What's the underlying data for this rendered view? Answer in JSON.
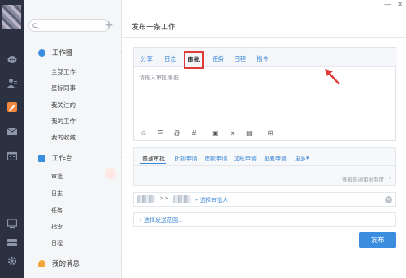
{
  "app": {
    "title": "发布一条工作"
  },
  "window": {
    "minimize": "—",
    "close": "✕"
  },
  "rail": {
    "icons": [
      "chat-icon",
      "contacts-icon",
      "work-icon",
      "mail-icon",
      "calendar-icon",
      "monitor-icon",
      "storage-icon",
      "settings-icon"
    ]
  },
  "sidebar": {
    "search_placeholder": "",
    "plus": "+",
    "groups": [
      {
        "label": "工作圈",
        "items": [
          "全部工作",
          "星标同事",
          "我关注的",
          "我的工作",
          "我的收藏"
        ]
      },
      {
        "label": "工作台",
        "items": [
          "审批",
          "日志",
          "任务",
          "指令",
          "日程"
        ]
      },
      {
        "label": "我的消息",
        "items": []
      }
    ]
  },
  "composer": {
    "tabs": [
      "分享",
      "日志",
      "审批",
      "任务",
      "日程",
      "指令"
    ],
    "active_tab": "审批",
    "placeholder": "请输入审批事由",
    "toolbar": [
      "emoji-icon",
      "list-icon",
      "mention-icon",
      "hashtag-icon",
      "image-icon",
      "attachment-icon",
      "document-icon",
      "table-icon"
    ]
  },
  "approval": {
    "types": [
      "普通审批",
      "折扣申请",
      "借款申请",
      "加班申请",
      "出差申请",
      "更多"
    ],
    "selected": "普通审批",
    "more_arrow": "▾",
    "rule_link": "查看普通审批制度",
    "rule_arrow": "›"
  },
  "approvers": {
    "arrow": "> >",
    "add_link": "+ 选择审批人",
    "clear": "×"
  },
  "scope": {
    "link": "+ 选择发送范围..."
  },
  "actions": {
    "publish": "发布"
  },
  "colors": {
    "accent": "#3b8de0",
    "highlight": "#e03b3b",
    "rail": "#2b3141"
  }
}
